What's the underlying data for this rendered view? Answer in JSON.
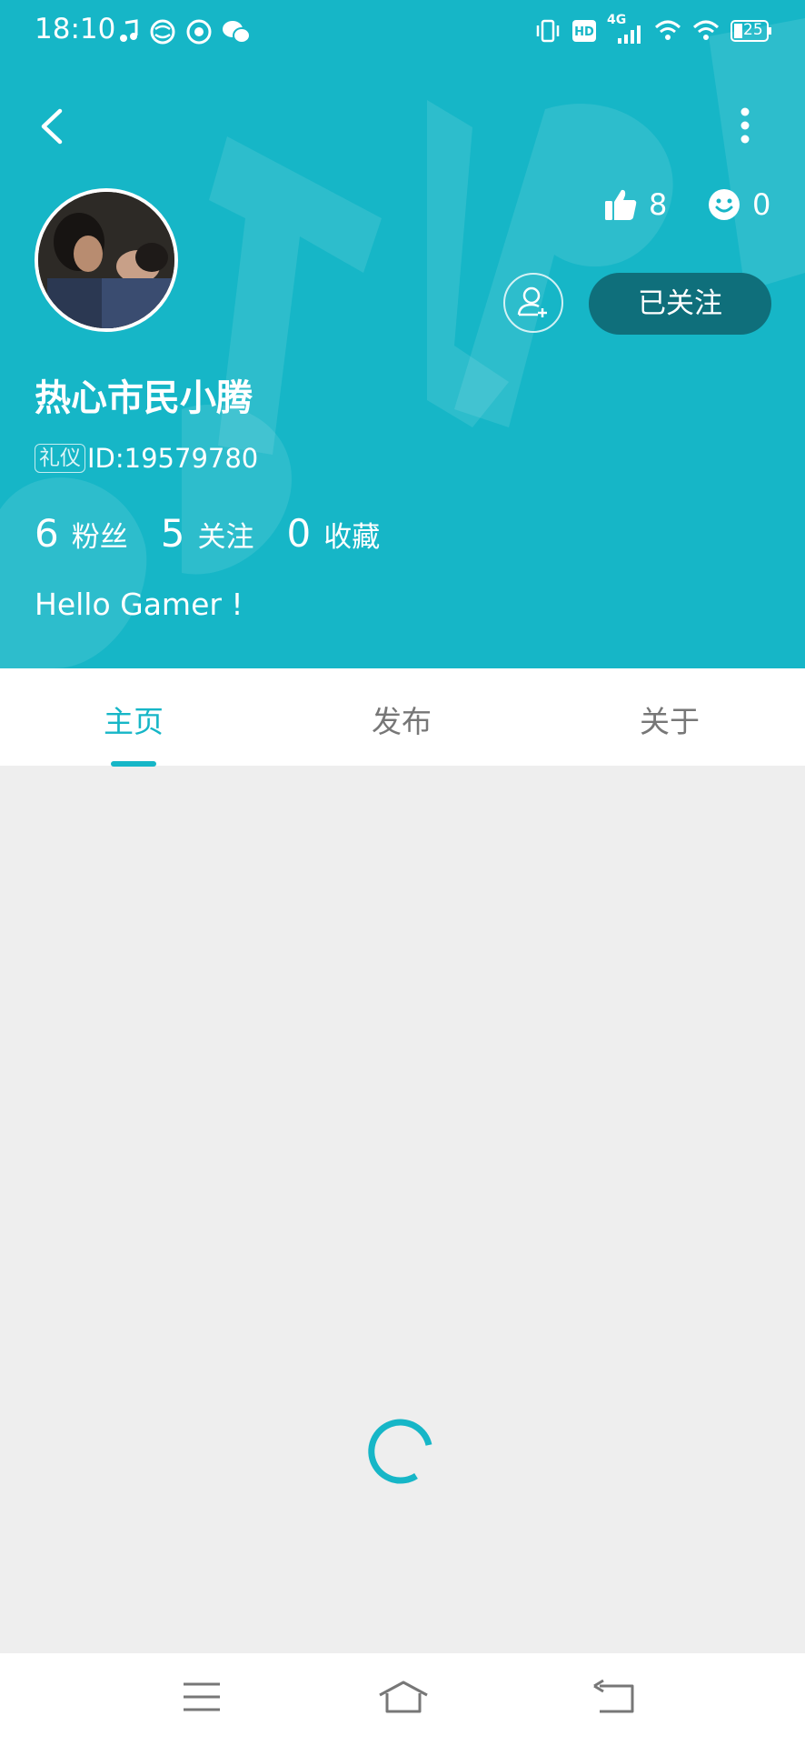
{
  "status_bar": {
    "time": "18:10",
    "network": "4G",
    "battery": "25"
  },
  "profile": {
    "username": "热心市民小腾",
    "badge": "礼仪",
    "id_text": "ID:19579780",
    "likes": "8",
    "smiles": "0",
    "follow_button": "已关注",
    "bio": "Hello Gamer !",
    "stats": [
      {
        "value": "6",
        "label": "粉丝"
      },
      {
        "value": "5",
        "label": "关注"
      },
      {
        "value": "0",
        "label": "收藏"
      }
    ]
  },
  "tabs": [
    {
      "label": "主页",
      "active": true
    },
    {
      "label": "发布",
      "active": false
    },
    {
      "label": "关于",
      "active": false
    }
  ],
  "colors": {
    "accent": "#16b6c7",
    "follow_button": "#0f6f7b",
    "content_bg": "#eeeeee"
  },
  "icons": {
    "back": "chevron-left-icon",
    "more": "more-vertical-icon",
    "like": "thumbs-up-icon",
    "smile": "smile-icon",
    "add_friend": "add-user-icon",
    "loading": "loading-spinner-icon",
    "nav_menu": "menu-icon",
    "nav_home": "home-icon",
    "nav_back": "return-icon"
  }
}
